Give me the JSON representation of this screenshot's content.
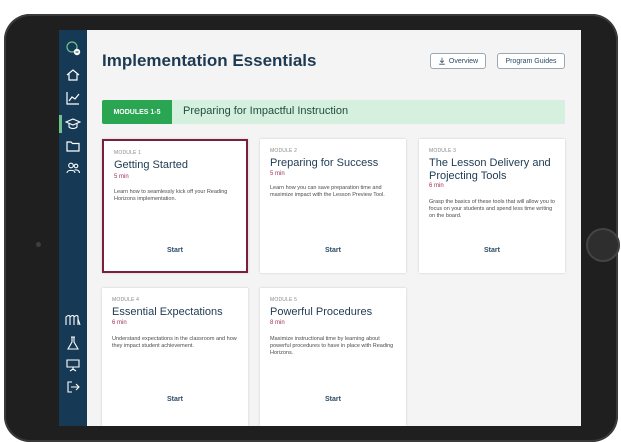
{
  "app": {
    "page_title": "Implementation Essentials"
  },
  "header": {
    "overview_label": "Overview",
    "program_guides_label": "Program Guides"
  },
  "banner": {
    "tag": "MODULES 1-5",
    "title": "Preparing for Impactful Instruction"
  },
  "sidebar": {
    "icons": [
      "logo-badge-icon",
      "home-icon",
      "chart-line-icon",
      "graduation-cap-icon",
      "folder-icon",
      "users-icon",
      "library-icon",
      "flask-icon",
      "presentation-icon",
      "logout-icon"
    ],
    "active_index": 3
  },
  "modules": [
    {
      "module_label": "MODULE 1",
      "title": "Getting Started",
      "duration": "5 min",
      "description": "Learn how to seamlessly kick off your Reading Horizons implementation.",
      "action": "Start"
    },
    {
      "module_label": "MODULE 2",
      "title": "Preparing for Success",
      "duration": "5 min",
      "description": "Learn how you can save preparation time and maximize impact with the Lesson Preview Tool.",
      "action": "Start"
    },
    {
      "module_label": "MODULE 3",
      "title": "The Lesson Delivery and Projecting Tools",
      "duration": "6 min",
      "description": "Grasp the basics of these tools that will allow you to focus on your students and spend less time writing on the board.",
      "action": "Start"
    },
    {
      "module_label": "MODULE 4",
      "title": "Essential Expectations",
      "duration": "6 min",
      "description": "Understand expectations in the classroom and how they impact student achievement.",
      "action": "Start"
    },
    {
      "module_label": "MODULE 5",
      "title": "Powerful Procedures",
      "duration": "8 min",
      "description": "Maximize instructional time by learning about powerful procedures to have in place with Reading Horizons.",
      "action": "Start"
    }
  ],
  "colors": {
    "sidebar": "#163a56",
    "accent_green": "#2aa552",
    "banner_bg": "#d6f0e0",
    "duration": "#a02f5a",
    "selected_border": "#7a1f3f"
  }
}
